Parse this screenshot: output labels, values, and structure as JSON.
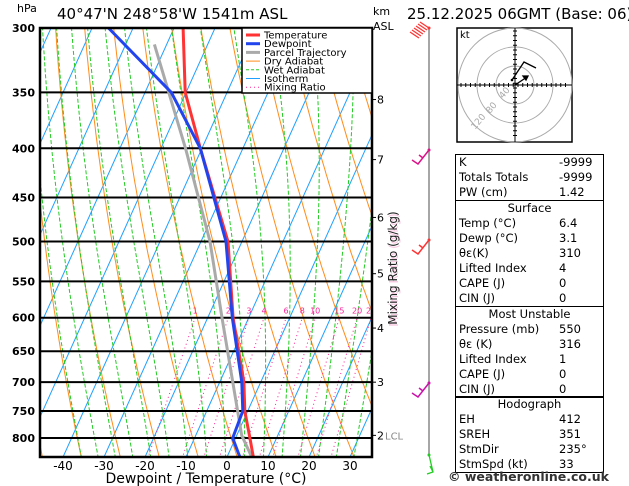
{
  "header": {
    "location": "40°47'N  248°58'W  1541m  ASL",
    "datetime": "25.12.2025  06GMT  (Base: 06)",
    "pressure_unit": "hPa",
    "height_unit_1": "km",
    "height_unit_2": "ASL"
  },
  "chart_data": {
    "type": "line",
    "subtype": "skew-t log-p",
    "xlabel": "Dewpoint / Temperature (°C)",
    "ylabel_left": "hPa",
    "ylabel_right": "Mixing Ratio (g/kg)",
    "x_ticks": [
      -40,
      -30,
      -20,
      -10,
      0,
      10,
      20,
      30
    ],
    "xlim": [
      -45,
      35
    ],
    "pressure_ticks": [
      300,
      350,
      400,
      450,
      500,
      550,
      600,
      650,
      700,
      750,
      800
    ],
    "ylim_hpa": [
      837,
      300
    ],
    "y_scale": "log",
    "altitude_ticks_km": [
      {
        "label": "8",
        "p": 356
      },
      {
        "label": "7",
        "p": 411
      },
      {
        "label": "6",
        "p": 472
      },
      {
        "label": "5",
        "p": 540
      },
      {
        "label": "4",
        "p": 615
      },
      {
        "label": "3",
        "p": 700
      },
      {
        "label": "2",
        "p": 795
      }
    ],
    "lcl_label": "LCL",
    "lcl_pressure": 795,
    "mixing_ratio_labels": [
      1,
      2,
      3,
      4,
      6,
      8,
      10,
      15,
      20,
      25
    ],
    "legend": {
      "position": "top-right",
      "entries": [
        {
          "label": "Temperature",
          "color": "#ff3333",
          "style": "thick"
        },
        {
          "label": "Dewpoint",
          "color": "#2244ee",
          "style": "thick"
        },
        {
          "label": "Parcel Trajectory",
          "color": "#aaaaaa",
          "style": "thick"
        },
        {
          "label": "Dry Adiabat",
          "color": "#ff8c1a",
          "style": "thin"
        },
        {
          "label": "Wet Adiabat",
          "color": "#22cc22",
          "style": "dashed"
        },
        {
          "label": "Isotherm",
          "color": "#1fa0ff",
          "style": "thin"
        },
        {
          "label": "Mixing Ratio",
          "color": "#ff2299",
          "style": "dotted"
        }
      ]
    },
    "series": [
      {
        "name": "Temperature",
        "color": "#ff3333",
        "p": [
          837,
          800,
          750,
          700,
          600,
          500,
          400,
          350,
          300
        ],
        "t": [
          6.4,
          3.5,
          -0.7,
          -4.1,
          -13.8,
          -23.4,
          -40.4,
          -50.2,
          -57.8
        ]
      },
      {
        "name": "Dewpoint",
        "color": "#2244ee",
        "p": [
          837,
          800,
          750,
          700,
          600,
          500,
          400,
          350,
          300
        ],
        "t": [
          3.1,
          -0.7,
          -1.2,
          -4.6,
          -14.0,
          -23.9,
          -40.4,
          -53.6,
          -76.0
        ]
      },
      {
        "name": "Parcel Trajectory",
        "color": "#aaaaaa",
        "p": [
          837,
          795,
          700,
          600,
          500,
          400,
          312
        ],
        "t": [
          6.0,
          1.2,
          -6.8,
          -16.5,
          -27.8,
          -44.0,
          -63.0
        ]
      }
    ]
  },
  "hodograph": {
    "unit": "kt",
    "ring_labels": [
      "40",
      "80",
      "120"
    ]
  },
  "indices": {
    "top": [
      {
        "label": "K",
        "value": "-9999"
      },
      {
        "label": "Totals Totals",
        "value": "-9999"
      },
      {
        "label": "PW (cm)",
        "value": "1.42"
      }
    ],
    "surface": {
      "title": "Surface",
      "rows": [
        {
          "label": "Temp (°C)",
          "value": "6.4"
        },
        {
          "label": "Dewp (°C)",
          "value": "3.1"
        },
        {
          "label": "θε(K)",
          "value": "310"
        },
        {
          "label": "Lifted Index",
          "value": "4"
        },
        {
          "label": "CAPE (J)",
          "value": "0"
        },
        {
          "label": "CIN (J)",
          "value": "0"
        }
      ]
    },
    "most_unstable": {
      "title": "Most Unstable",
      "rows": [
        {
          "label": "Pressure (mb)",
          "value": "550"
        },
        {
          "label": "θε (K)",
          "value": "316"
        },
        {
          "label": "Lifted Index",
          "value": "1"
        },
        {
          "label": "CAPE (J)",
          "value": "0"
        },
        {
          "label": "CIN (J)",
          "value": "0"
        }
      ]
    },
    "hodograph": {
      "title": "Hodograph",
      "rows": [
        {
          "label": "EH",
          "value": "412"
        },
        {
          "label": "SREH",
          "value": "351"
        },
        {
          "label": "StmDir",
          "value": "235°"
        },
        {
          "label": "StmSpd (kt)",
          "value": "33"
        }
      ]
    }
  },
  "footer": {
    "copyright": "© weatheronline.co.uk"
  }
}
